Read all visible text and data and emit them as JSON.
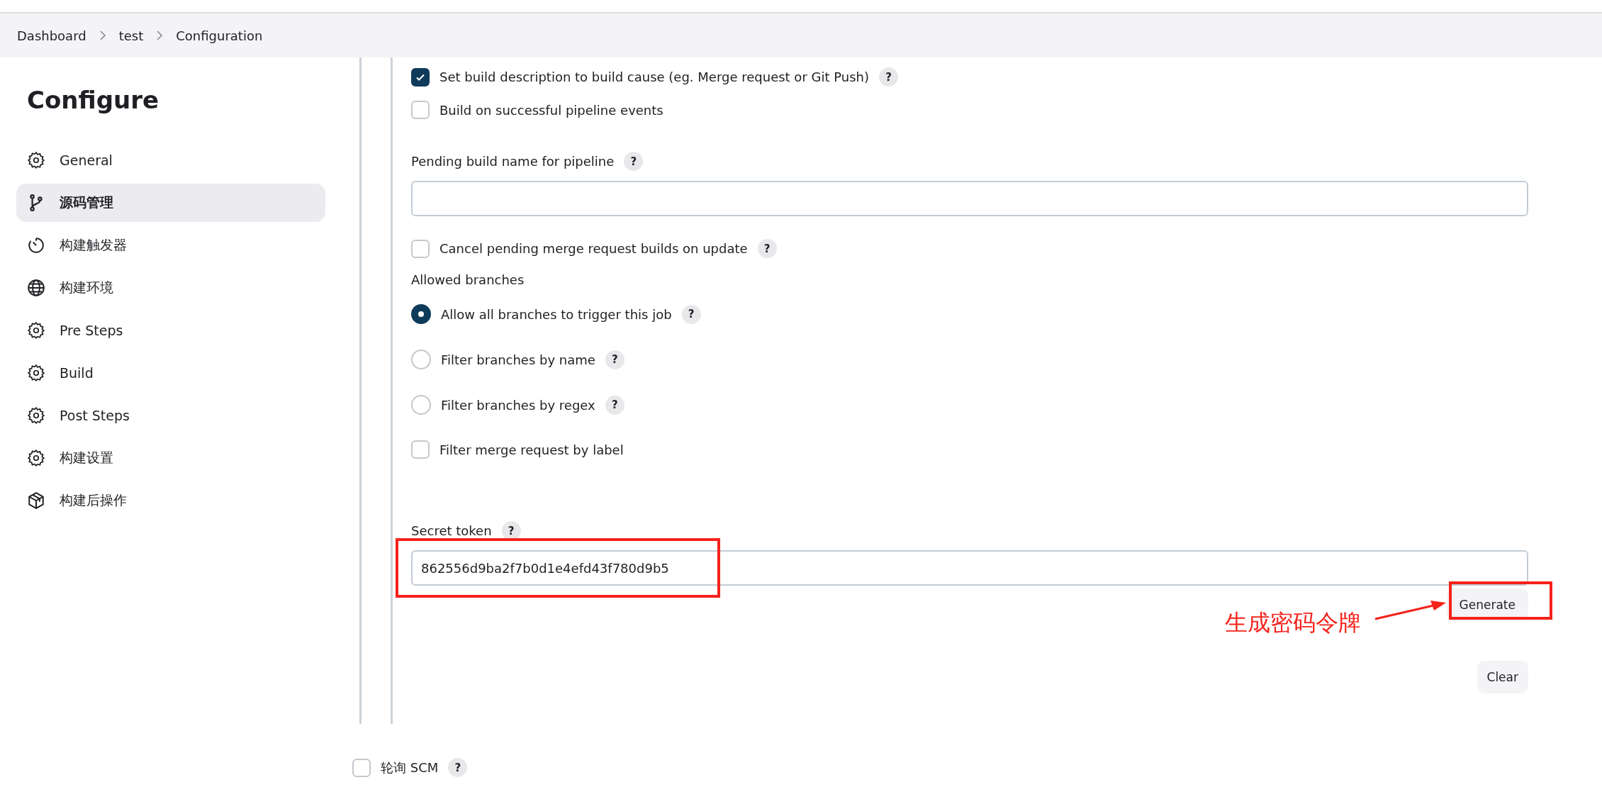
{
  "breadcrumbs": [
    {
      "label": "Dashboard"
    },
    {
      "label": "test"
    },
    {
      "label": "Configuration"
    }
  ],
  "sidebar": {
    "title": "Configure",
    "items": [
      {
        "label": "General",
        "selected": false
      },
      {
        "label": "源码管理",
        "selected": true
      },
      {
        "label": "构建触发器",
        "selected": false
      },
      {
        "label": "构建环境",
        "selected": false
      },
      {
        "label": "Pre Steps",
        "selected": false
      },
      {
        "label": "Build",
        "selected": false
      },
      {
        "label": "Post Steps",
        "selected": false
      },
      {
        "label": "构建设置",
        "selected": false
      },
      {
        "label": "构建后操作",
        "selected": false
      }
    ]
  },
  "form": [
    {
      "kind": "checkbox",
      "label": "Set build description to build cause (eg. Merge request or Git Push)",
      "checked": true,
      "help": "?"
    },
    {
      "kind": "checkbox",
      "label": "Build on successful pipeline events",
      "checked": false
    },
    {
      "kind": "field",
      "label": "Pending build name for pipeline",
      "help": "?"
    },
    {
      "kind": "checkbox",
      "label": "Cancel pending merge request builds on update",
      "checked": false,
      "help": "?"
    },
    {
      "kind": "heading",
      "label": "Allowed branches"
    },
    {
      "kind": "radio",
      "label": "Allow all branches to trigger this job",
      "selected": true,
      "help": "?"
    },
    {
      "kind": "radio",
      "label": "Filter branches by name",
      "selected": false,
      "help": "?"
    },
    {
      "kind": "radio",
      "label": "Filter branches by regex",
      "selected": false,
      "help": "?"
    },
    {
      "kind": "checkbox",
      "label": "Filter merge request by label",
      "checked": false
    }
  ],
  "secret_token": {
    "label": "Secret token",
    "help": "?",
    "value": "862556d9ba2f7b0d1e4efd43f780d9b5",
    "generate": "Generate",
    "clear": "Clear"
  },
  "annotation": {
    "text": "生成密码令牌"
  },
  "poll_scm": {
    "label": "轮询 SCM",
    "checked": false,
    "help": "?"
  }
}
